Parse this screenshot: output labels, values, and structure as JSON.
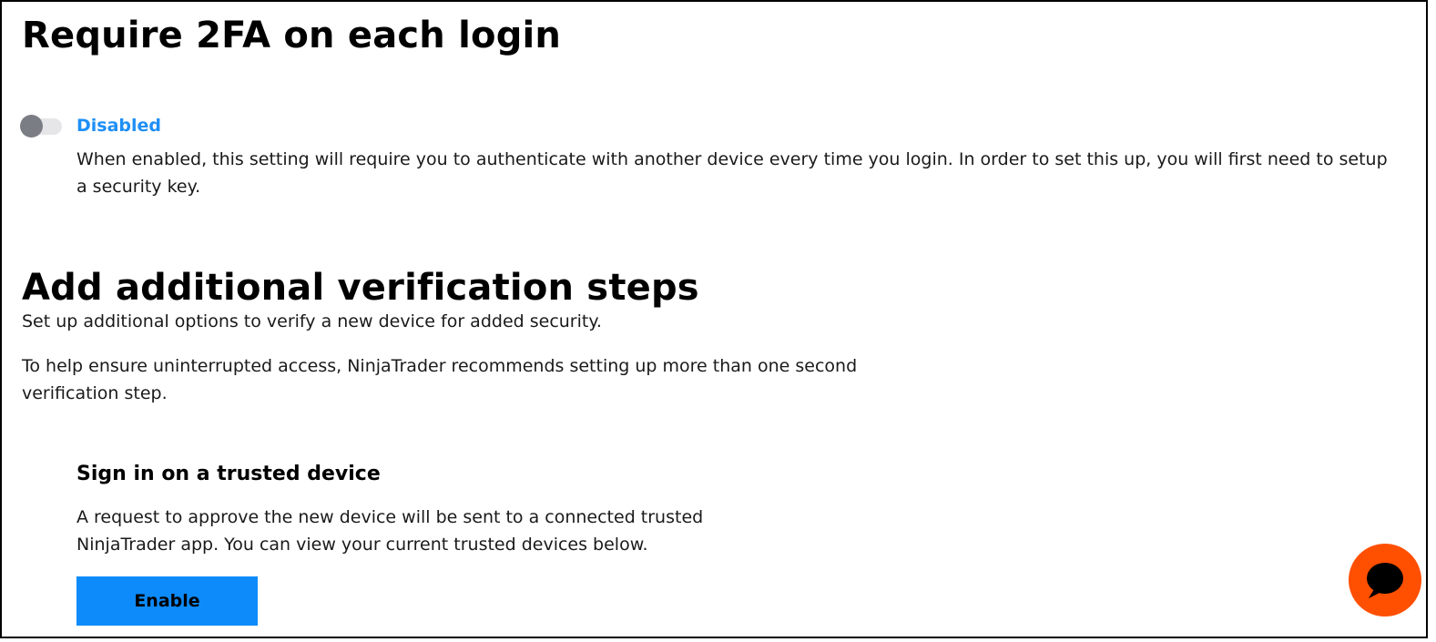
{
  "twofa": {
    "title": "Require 2FA on each login",
    "toggle_state": "off",
    "status_label": "Disabled",
    "description": "When enabled, this setting will require you to authenticate with another device every time you login. In order to set this up, you will first need to setup a security key."
  },
  "verification": {
    "title": "Add additional verification steps",
    "subtitle": "Set up additional options to verify a new device for added security.",
    "recommendation": "To help ensure uninterrupted access, NinjaTrader recommends setting up more than one second verification step."
  },
  "trusted_device": {
    "title": "Sign in on a trusted device",
    "description": "A request to approve the new device will be sent to a connected trusted NinjaTrader app. You can view your current trusted devices below.",
    "enable_label": "Enable"
  },
  "chat": {
    "icon": "chat-bubble-icon"
  },
  "colors": {
    "accent_blue": "#1e8ff6",
    "button_blue": "#0d8bfb",
    "chat_orange": "#ff4f00",
    "toggle_knob": "#7b7d84",
    "toggle_track": "#e6e6e9"
  }
}
